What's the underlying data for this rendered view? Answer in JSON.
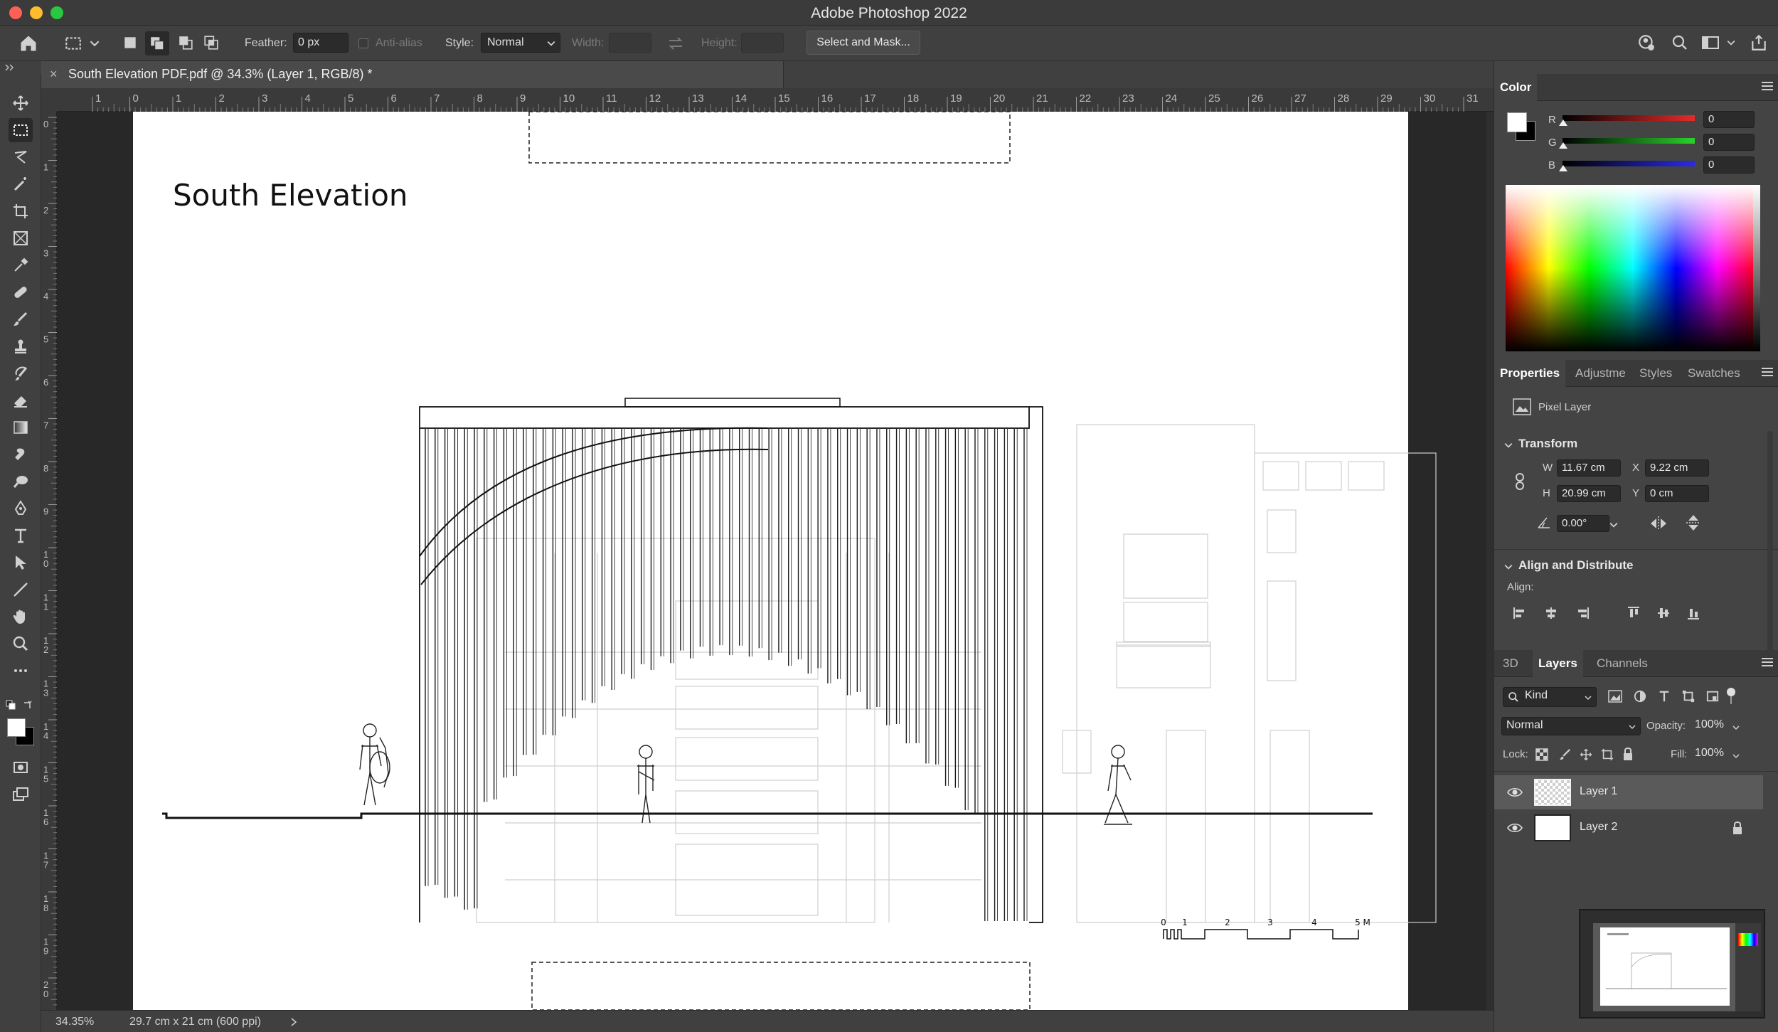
{
  "app": {
    "title": "Adobe Photoshop 2022"
  },
  "options": {
    "feather_label": "Feather:",
    "feather_value": "0 px",
    "antialias_label": "Anti-alias",
    "style_label": "Style:",
    "style_value": "Normal",
    "width_label": "Width:",
    "height_label": "Height:",
    "select_mask_label": "Select and Mask..."
  },
  "document": {
    "tab_title": "South Elevation PDF.pdf @ 34.3% (Layer 1, RGB/8) *",
    "drawing_title": "South Elevation",
    "scale_labels": [
      "0",
      "1",
      "2",
      "3",
      "4",
      "5 M"
    ]
  },
  "rulers": {
    "top": [
      "1",
      "0",
      "1",
      "2",
      "3",
      "4",
      "5",
      "6",
      "7",
      "8",
      "9",
      "10",
      "11",
      "12",
      "13",
      "14",
      "15",
      "16",
      "17",
      "18",
      "19",
      "20",
      "21",
      "22",
      "23",
      "24",
      "25",
      "26",
      "27",
      "28",
      "29",
      "30",
      "31"
    ],
    "left": [
      "0",
      "1",
      "2",
      "3",
      "4",
      "5",
      "6",
      "7",
      "8",
      "9",
      "10",
      "11",
      "12",
      "13",
      "14",
      "15",
      "16",
      "17",
      "18",
      "19",
      "20"
    ]
  },
  "status": {
    "zoom": "34.35%",
    "doc_size": "29.7 cm x 21 cm (600 ppi)"
  },
  "color_panel": {
    "title": "Color",
    "channels": [
      {
        "name": "R",
        "value": "0"
      },
      {
        "name": "G",
        "value": "0"
      },
      {
        "name": "B",
        "value": "0"
      }
    ],
    "colors": {
      "r": "#e52a2a",
      "g": "#2ad22a",
      "b": "#2a2ae5"
    }
  },
  "properties_panel": {
    "tabs": [
      "Properties",
      "Adjustme",
      "Styles",
      "Swatches"
    ],
    "layer_kind": "Pixel Layer",
    "transform_title": "Transform",
    "w_label": "W",
    "w_value": "11.67 cm",
    "x_label": "X",
    "x_value": "9.22 cm",
    "h_label": "H",
    "h_value": "20.99 cm",
    "y_label": "Y",
    "y_value": "0 cm",
    "angle_value": "0.00°",
    "align_title": "Align and Distribute",
    "align_label": "Align:"
  },
  "layers_panel": {
    "tabs": [
      "3D",
      "Layers",
      "Channels"
    ],
    "filter_kind": "Kind",
    "blend_mode": "Normal",
    "opacity_label": "Opacity:",
    "opacity_value": "100%",
    "lock_label": "Lock:",
    "fill_label": "Fill:",
    "fill_value": "100%",
    "layers": [
      {
        "name": "Layer 1",
        "selected": true
      },
      {
        "name": "Layer 2",
        "selected": false,
        "locked": true
      }
    ]
  }
}
